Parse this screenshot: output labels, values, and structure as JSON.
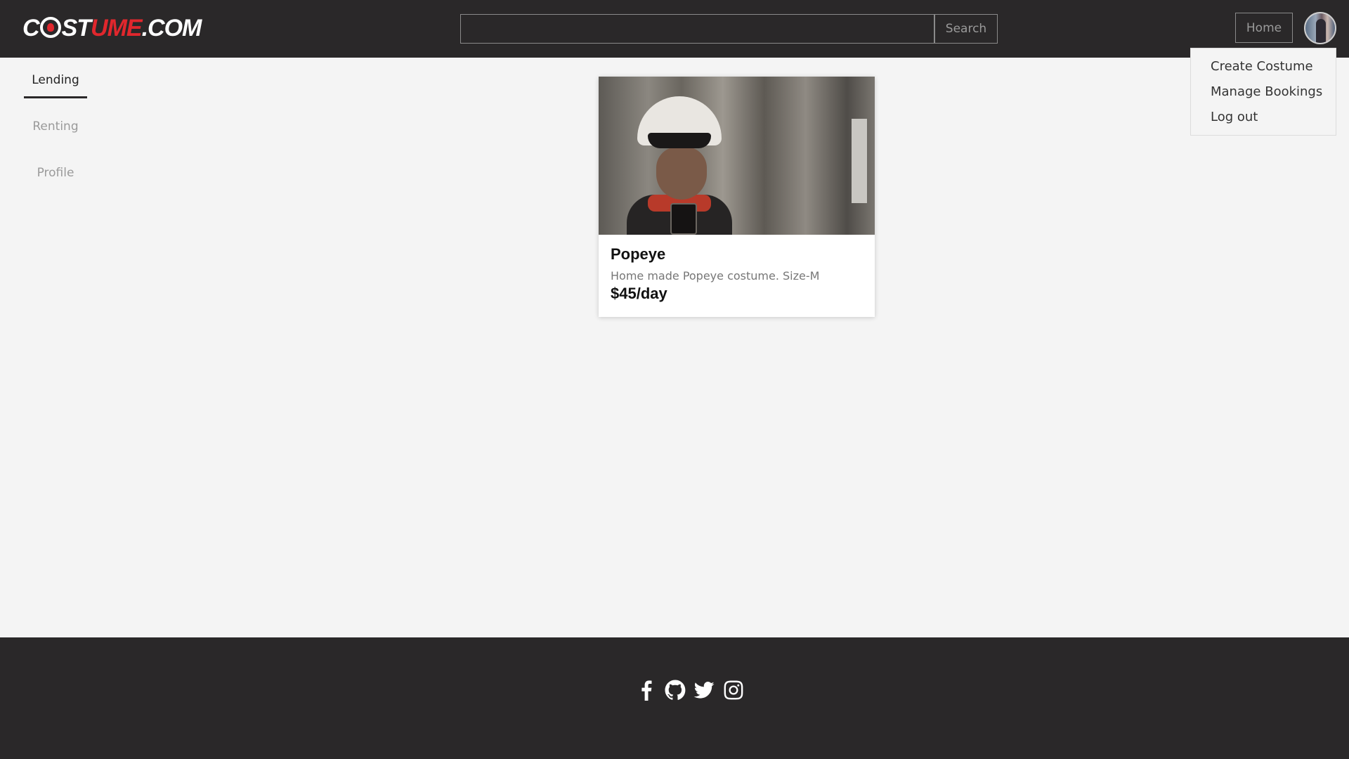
{
  "header": {
    "logo": {
      "part1": "C",
      "part2": "ST",
      "part3": "UME",
      "part4": ".COM"
    },
    "search": {
      "value": "",
      "placeholder": "",
      "button_label": "Search"
    },
    "home_label": "Home"
  },
  "user_menu": {
    "items": [
      {
        "label": "Create Costume"
      },
      {
        "label": "Manage Bookings"
      },
      {
        "label": "Log out"
      }
    ]
  },
  "sidebar": {
    "items": [
      {
        "label": "Lending",
        "active": true
      },
      {
        "label": "Renting",
        "active": false
      },
      {
        "label": "Profile",
        "active": false
      }
    ]
  },
  "listings": [
    {
      "title": "Popeye",
      "description": "Home made Popeye costume. Size-M",
      "price": "$45/day"
    }
  ],
  "footer": {
    "social_icons": [
      "facebook-icon",
      "github-icon",
      "twitter-icon",
      "instagram-icon"
    ]
  },
  "colors": {
    "header_bg": "#2a2829",
    "page_bg": "#f4f4f4",
    "brand_accent": "#e0272d"
  }
}
